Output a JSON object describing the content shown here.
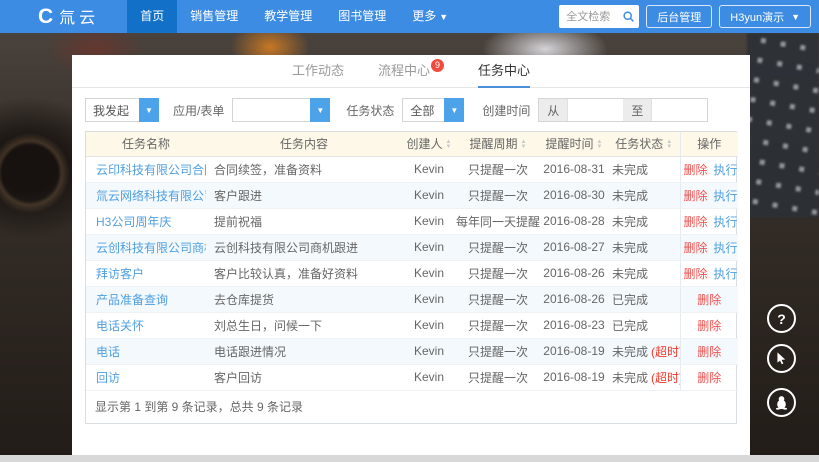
{
  "navbar": {
    "logo_glyph": "C",
    "logo_text": "氚云",
    "menu": [
      {
        "label": "首页",
        "active": true
      },
      {
        "label": "销售管理",
        "active": false
      },
      {
        "label": "教学管理",
        "active": false
      },
      {
        "label": "图书管理",
        "active": false
      },
      {
        "label": "更多",
        "active": false
      }
    ],
    "search_placeholder": "全文检索",
    "admin_button": "后台管理",
    "user_button": "H3yun演示"
  },
  "tabs": [
    {
      "label": "工作动态",
      "badge": ""
    },
    {
      "label": "流程中心",
      "badge": "9"
    },
    {
      "label": "任务中心",
      "badge": "",
      "active": true
    }
  ],
  "filters": {
    "originator_value": "我发起",
    "app_form_label": "应用/表单",
    "app_form_value": "",
    "task_status_label": "任务状态",
    "task_status_value": "全部",
    "created_time_label": "创建时间",
    "from_label": "从",
    "to_label": "至",
    "from_value": "",
    "to_value": ""
  },
  "table": {
    "columns": [
      {
        "label": "任务名称",
        "sortable": false
      },
      {
        "label": "任务内容",
        "sortable": false
      },
      {
        "label": "创建人",
        "sortable": true
      },
      {
        "label": "提醒周期",
        "sortable": true
      },
      {
        "label": "提醒时间",
        "sortable": true
      },
      {
        "label": "任务状态",
        "sortable": true
      },
      {
        "label": "操作",
        "sortable": false
      }
    ],
    "rows": [
      {
        "name": "云印科技有限公司合同到期",
        "content": "合同续签，准备资料",
        "creator": "Kevin",
        "cycle": "只提醒一次",
        "time": "2016-08-31",
        "status": "未完成",
        "overdue": "",
        "actions": [
          "删除",
          "执行"
        ]
      },
      {
        "name": "氚云网络科技有限公司跟进",
        "content": "客户跟进",
        "creator": "Kevin",
        "cycle": "只提醒一次",
        "time": "2016-08-30",
        "status": "未完成",
        "overdue": "",
        "actions": [
          "删除",
          "执行"
        ]
      },
      {
        "name": "H3公司周年庆",
        "content": "提前祝福",
        "creator": "Kevin",
        "cycle": "每年同一天提醒",
        "time": "2016-08-28",
        "status": "未完成",
        "overdue": "",
        "actions": [
          "删除",
          "执行"
        ]
      },
      {
        "name": "云创科技有限公司商机跟进",
        "content": "云创科技有限公司商机跟进",
        "creator": "Kevin",
        "cycle": "只提醒一次",
        "time": "2016-08-27",
        "status": "未完成",
        "overdue": "",
        "actions": [
          "删除",
          "执行"
        ]
      },
      {
        "name": "拜访客户",
        "content": "客户比较认真，准备好资料",
        "creator": "Kevin",
        "cycle": "只提醒一次",
        "time": "2016-08-26",
        "status": "未完成",
        "overdue": "",
        "actions": [
          "删除",
          "执行"
        ]
      },
      {
        "name": "产品准备查询",
        "content": "去仓库提货",
        "creator": "Kevin",
        "cycle": "只提醒一次",
        "time": "2016-08-26",
        "status": "已完成",
        "overdue": "",
        "actions": [
          "删除"
        ]
      },
      {
        "name": "电话关怀",
        "content": "刘总生日，问候一下",
        "creator": "Kevin",
        "cycle": "只提醒一次",
        "time": "2016-08-23",
        "status": "已完成",
        "overdue": "",
        "actions": [
          "删除"
        ]
      },
      {
        "name": "电话",
        "content": "电话跟进情况",
        "creator": "Kevin",
        "cycle": "只提醒一次",
        "time": "2016-08-19",
        "status": "未完成",
        "overdue": "(超时)",
        "actions": [
          "删除"
        ]
      },
      {
        "name": "回访",
        "content": "客户回访",
        "creator": "Kevin",
        "cycle": "只提醒一次",
        "time": "2016-08-19",
        "status": "未完成",
        "overdue": "(超时)",
        "actions": [
          "删除"
        ]
      }
    ],
    "summary": "显示第 1 到第 9 条记录，总共 9 条记录"
  },
  "floating": {
    "help_glyph": "?"
  },
  "colors": {
    "navbar": "#3d8ce4",
    "navbar_active": "#1270c8",
    "link": "#4f9fe0",
    "danger": "#ef5350",
    "overdue": "#f0382b",
    "badge": "#f04b3e",
    "table_header_bg": "#fdf8e8",
    "tab_underline": "#4a90d9",
    "select_button": "#4da3ea"
  }
}
